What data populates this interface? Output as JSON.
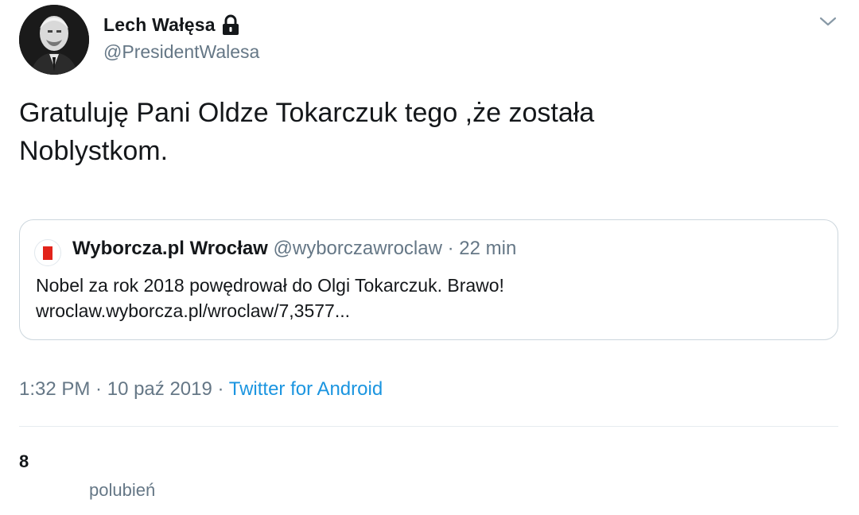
{
  "author": {
    "display_name": "Lech Wałęsa",
    "handle": "@PresidentWalesa",
    "avatar_icon": "profile-photo",
    "protected_icon": "lock-icon"
  },
  "tweet": {
    "text_line1": "Gratuluję Pani Oldze Tokarczuk tego ,że została",
    "text_line2": "Noblystkom."
  },
  "quoted_tweet": {
    "name": "Wyborcza.pl Wrocław",
    "handle": "@wyborczawroclaw",
    "separator": " · ",
    "time_ago": "22 min",
    "text_line1": "Nobel za rok 2018 powędrował do Olgi Tokarczuk. Brawo!",
    "text_line2": "wroclaw.wyborcza.pl/wroclaw/7,3577..."
  },
  "meta": {
    "time": "1:32 PM",
    "sep1": " · ",
    "date": "10 paź 2019",
    "sep2": " · ",
    "source": "Twitter for Android"
  },
  "stats": {
    "likes_count": "8",
    "likes_label": "polubień"
  },
  "colors": {
    "text": "#14171a",
    "secondary": "#657786",
    "link": "#1b95e0",
    "border": "#ccd6dd",
    "wyborcza_red": "#e2231a"
  }
}
